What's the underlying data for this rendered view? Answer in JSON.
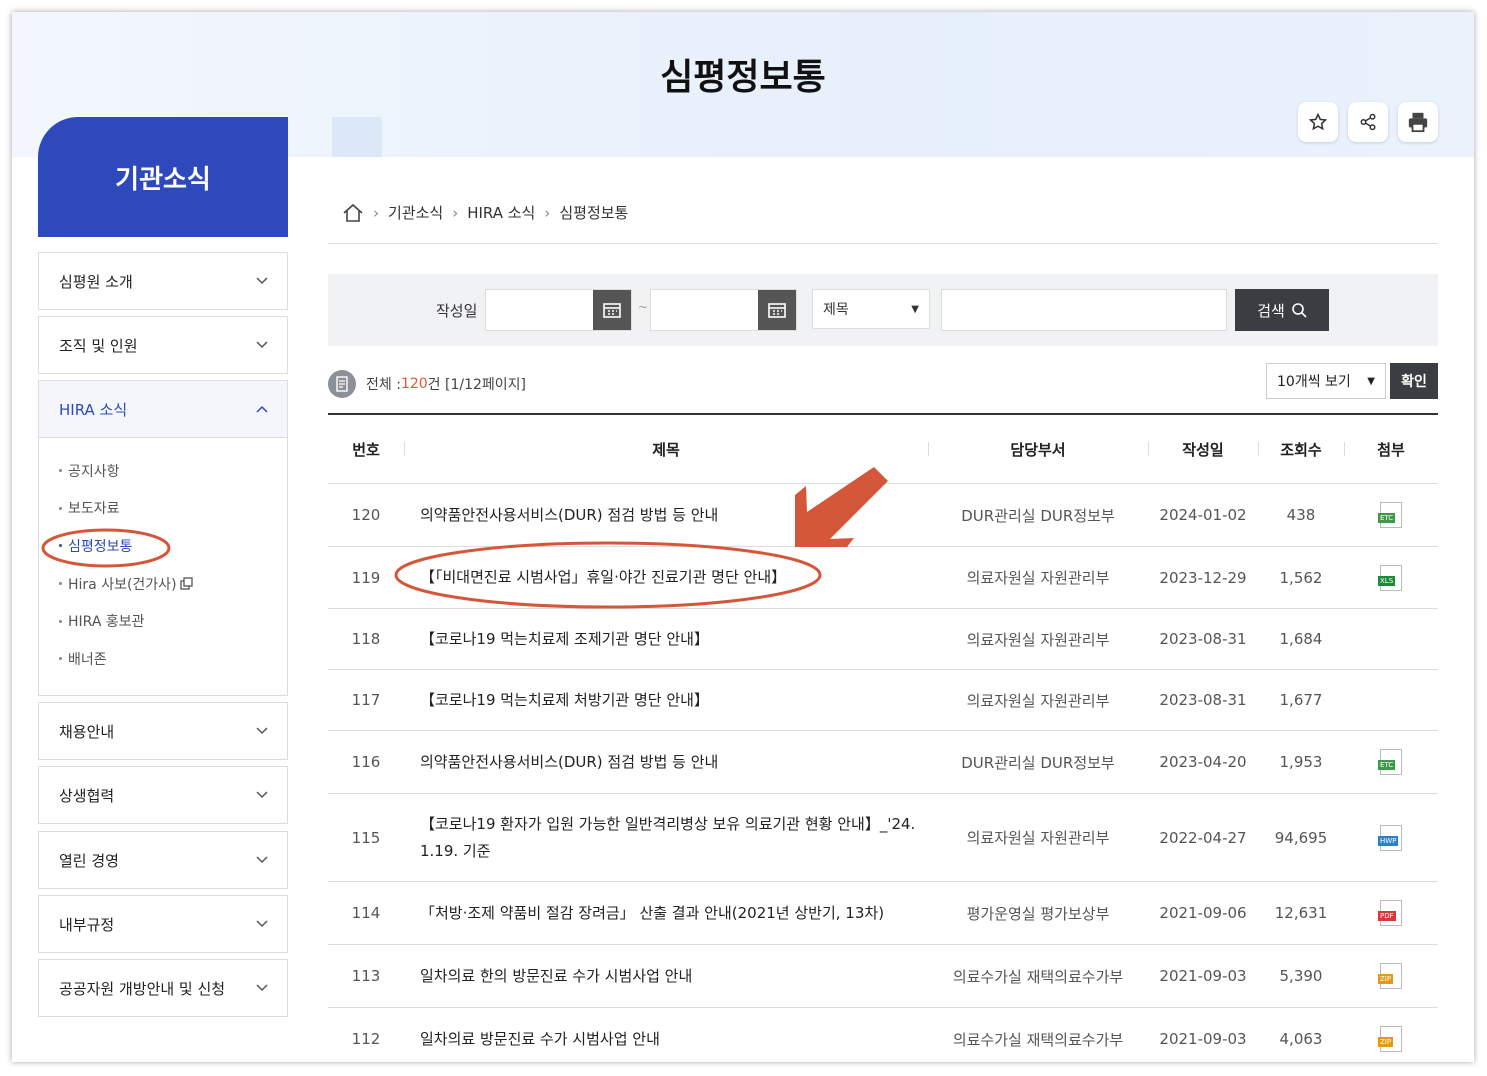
{
  "page": {
    "title": "심평정보통"
  },
  "tools": {
    "favorite_icon": "star-icon",
    "share_icon": "share-icon",
    "print_icon": "print-icon"
  },
  "sidebar": {
    "heading": "기관소식",
    "menus_top": [
      {
        "label": "심평원 소개"
      },
      {
        "label": "조직 및 인원"
      }
    ],
    "active_menu": {
      "label": "HIRA 소식"
    },
    "sub_items": [
      {
        "label": "공지사항"
      },
      {
        "label": "보도자료"
      },
      {
        "label": "심평정보통"
      },
      {
        "label": "Hira 사보(건가사)"
      },
      {
        "label": "HIRA 홍보관"
      },
      {
        "label": "배너존"
      }
    ],
    "menus_bottom": [
      {
        "label": "채용안내"
      },
      {
        "label": "상생협력"
      },
      {
        "label": "열린 경영"
      },
      {
        "label": "내부규정"
      },
      {
        "label": "공공자원 개방안내 및 신청"
      }
    ]
  },
  "breadcrumb": [
    "기관소식",
    "HIRA 소식",
    "심평정보통"
  ],
  "search": {
    "date_label": "작성일",
    "tilde": "~",
    "field_select": "제목",
    "button": "검색"
  },
  "summary": {
    "prefix": "전체 : ",
    "count": "120",
    "suffix": "건 [1/12페이지]"
  },
  "page_size": {
    "label": "10개씩 보기",
    "confirm": "확인"
  },
  "table": {
    "headers": [
      "번호",
      "제목",
      "담당부서",
      "작성일",
      "조회수",
      "첨부"
    ],
    "rows": [
      {
        "no": "120",
        "title": "의약품안전사용서비스(DUR) 점검 방법 등 안내",
        "dept": "DUR관리실 DUR정보부",
        "date": "2024-01-02",
        "views": "438",
        "file": "ETC"
      },
      {
        "no": "119",
        "title": "【「비대면진료 시범사업」휴일·야간 진료기관 명단 안내】",
        "dept": "의료자원실 자원관리부",
        "date": "2023-12-29",
        "views": "1,562",
        "file": "XLS"
      },
      {
        "no": "118",
        "title": "【코로나19 먹는치료제 조제기관 명단 안내】",
        "dept": "의료자원실 자원관리부",
        "date": "2023-08-31",
        "views": "1,684",
        "file": ""
      },
      {
        "no": "117",
        "title": "【코로나19 먹는치료제 처방기관 명단 안내】",
        "dept": "의료자원실 자원관리부",
        "date": "2023-08-31",
        "views": "1,677",
        "file": ""
      },
      {
        "no": "116",
        "title": "의약품안전사용서비스(DUR) 점검 방법 등 안내",
        "dept": "DUR관리실 DUR정보부",
        "date": "2023-04-20",
        "views": "1,953",
        "file": "ETC"
      },
      {
        "no": "115",
        "title": "【코로나19 환자가 입원 가능한 일반격리병상 보유 의료기관 현황 안내】_'24. 1.19. 기준",
        "dept": "의료자원실 자원관리부",
        "date": "2022-04-27",
        "views": "94,695",
        "file": "HWP"
      },
      {
        "no": "114",
        "title": "「처방·조제 약품비 절감 장려금」 산출 결과 안내(2021년 상반기, 13차)",
        "dept": "평가운영실 평가보상부",
        "date": "2021-09-06",
        "views": "12,631",
        "file": "PDF"
      },
      {
        "no": "113",
        "title": "일차의료 한의 방문진료 수가 시범사업 안내",
        "dept": "의료수가실 재택의료수가부",
        "date": "2021-09-03",
        "views": "5,390",
        "file": "ZIP"
      },
      {
        "no": "112",
        "title": "일차의료 방문진료 수가 시범사업 안내",
        "dept": "의료수가실 재택의료수가부",
        "date": "2021-09-03",
        "views": "4,063",
        "file": "ZIP"
      }
    ]
  },
  "colors": {
    "primary": "#2d49bb",
    "accent": "#e4572e",
    "annotation": "#d4573a",
    "dark_button": "#3a3d42"
  }
}
